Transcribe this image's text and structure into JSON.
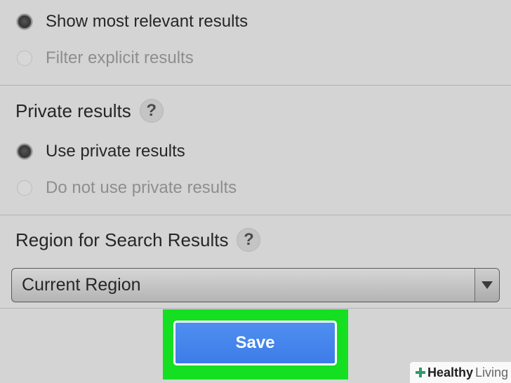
{
  "safe_search": {
    "options": [
      {
        "label": "Show most relevant results",
        "selected": true
      },
      {
        "label": "Filter explicit results",
        "selected": false
      }
    ]
  },
  "private_results": {
    "heading": "Private results",
    "help_symbol": "?",
    "options": [
      {
        "label": "Use private results",
        "selected": true
      },
      {
        "label": "Do not use private results",
        "selected": false
      }
    ]
  },
  "region": {
    "heading": "Region for Search Results",
    "help_symbol": "?",
    "selected_value": "Current Region"
  },
  "actions": {
    "save_label": "Save"
  },
  "watermark": {
    "brand_bold": "Healthy",
    "brand_light": "Living"
  },
  "colors": {
    "background": "#d4d4d4",
    "save_button": "#4687ee",
    "highlight": "#14e021"
  }
}
